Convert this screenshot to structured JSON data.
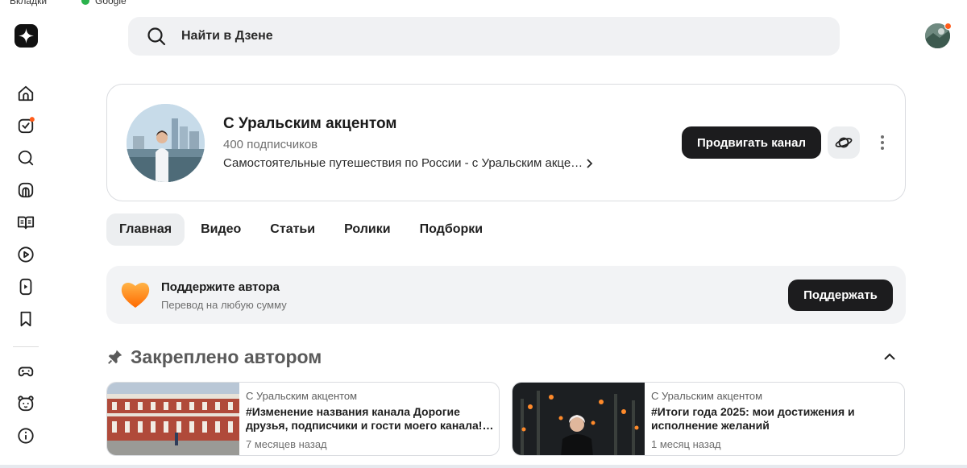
{
  "browser": {
    "bookmarks_label": "Вкладки",
    "google_label": "Google"
  },
  "search": {
    "placeholder": "Найти в Дзене"
  },
  "sidebar": {
    "items": [
      {
        "icon": "home-icon"
      },
      {
        "icon": "subscriptions-icon",
        "has_badge": true
      },
      {
        "icon": "search-icon"
      },
      {
        "icon": "media-icon"
      },
      {
        "icon": "articles-icon"
      },
      {
        "icon": "video-icon"
      },
      {
        "icon": "shorts-icon"
      },
      {
        "icon": "bookmark-icon"
      },
      {
        "icon": "games-icon"
      },
      {
        "icon": "kids-icon"
      },
      {
        "icon": "info-icon"
      }
    ]
  },
  "channel": {
    "name": "С Уральским акцентом",
    "subscribers": "400 подписчиков",
    "description": "Самостоятельные путешествия по России - с Уральским акце…",
    "promote_label": "Продвигать канал"
  },
  "tabs": [
    {
      "label": "Главная",
      "active": true
    },
    {
      "label": "Видео",
      "active": false
    },
    {
      "label": "Статьи",
      "active": false
    },
    {
      "label": "Ролики",
      "active": false
    },
    {
      "label": "Подборки",
      "active": false
    }
  ],
  "support": {
    "title": "Поддержите автора",
    "subtitle": "Перевод на любую сумму",
    "button_label": "Поддержать"
  },
  "pinned": {
    "title": "Закреплено автором",
    "posts": [
      {
        "channel": "С Уральским акцентом",
        "title": "#Изменение названия канала Дорогие друзья, подписчики и гости моего канала! Меня зовут…",
        "date": "7 месяцев назад"
      },
      {
        "channel": "С Уральским акцентом",
        "title": "#Итоги года 2025: мои достижения и исполнение желаний",
        "date": "1 месяц назад"
      }
    ]
  },
  "colors": {
    "accent_dark": "#1c1c1e",
    "badge": "#ff5c1a",
    "heart": "#ff8a1f"
  }
}
